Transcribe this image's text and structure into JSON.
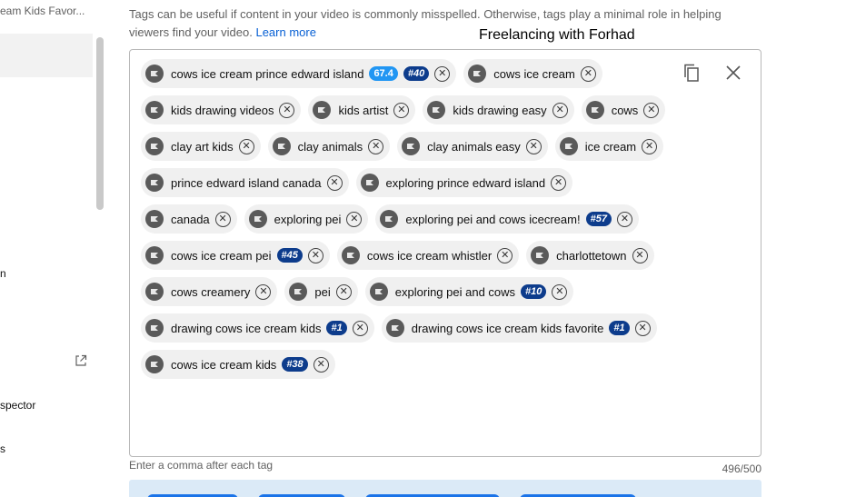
{
  "sidebar": {
    "video_title": "eam Kids Favor...",
    "items": [
      {
        "label": "n"
      },
      {
        "label": "spector"
      },
      {
        "label": "s"
      }
    ],
    "external_icon": "external-link-icon"
  },
  "help": {
    "text": "Tags can be useful if content in your video is commonly misspelled. Otherwise, tags play a minimal role in helping viewers find your video.",
    "link": "Learn more"
  },
  "watermark": "Freelancing with Forhad",
  "actions": {
    "copy_icon": "copy-icon",
    "clear_icon": "close-icon"
  },
  "tags": [
    {
      "label": "cows ice cream prince edward island",
      "badges": [
        {
          "text": "67.4",
          "style": "light"
        },
        {
          "text": "#40",
          "style": "dark"
        }
      ]
    },
    {
      "label": "cows ice cream",
      "badges": []
    },
    {
      "label": "kids drawing videos",
      "badges": []
    },
    {
      "label": "kids artist",
      "badges": []
    },
    {
      "label": "kids drawing easy",
      "badges": []
    },
    {
      "label": "cows",
      "badges": []
    },
    {
      "label": "clay art kids",
      "badges": []
    },
    {
      "label": "clay animals",
      "badges": []
    },
    {
      "label": "clay animals easy",
      "badges": []
    },
    {
      "label": "ice cream",
      "badges": []
    },
    {
      "label": "prince edward island canada",
      "badges": []
    },
    {
      "label": "exploring prince edward island",
      "badges": []
    },
    {
      "label": "canada",
      "badges": []
    },
    {
      "label": "exploring pei",
      "badges": []
    },
    {
      "label": "exploring pei and cows icecream!",
      "badges": [
        {
          "text": "#57",
          "style": "dark"
        }
      ]
    },
    {
      "label": "cows ice cream pei",
      "badges": [
        {
          "text": "#45",
          "style": "dark"
        }
      ]
    },
    {
      "label": "cows ice cream whistler",
      "badges": []
    },
    {
      "label": "charlottetown",
      "badges": []
    },
    {
      "label": "cows creamery",
      "badges": []
    },
    {
      "label": "pei",
      "badges": []
    },
    {
      "label": "exploring pei and cows",
      "badges": [
        {
          "text": "#10",
          "style": "dark"
        }
      ]
    },
    {
      "label": "drawing cows ice cream kids",
      "badges": [
        {
          "text": "#1",
          "style": "dark"
        }
      ]
    },
    {
      "label": "drawing cows ice cream kids favorite",
      "badges": [
        {
          "text": "#1",
          "style": "dark"
        }
      ]
    },
    {
      "label": "cows ice cream kids",
      "badges": [
        {
          "text": "#38",
          "style": "dark"
        }
      ]
    }
  ],
  "footer": {
    "hint": "Enter a comma after each tag",
    "counter": "496/500"
  },
  "colors": {
    "badge_light": "#2196f3",
    "badge_dark": "#0d3c8c",
    "link": "#065fd4",
    "chip_bg": "#f0f0f0"
  }
}
